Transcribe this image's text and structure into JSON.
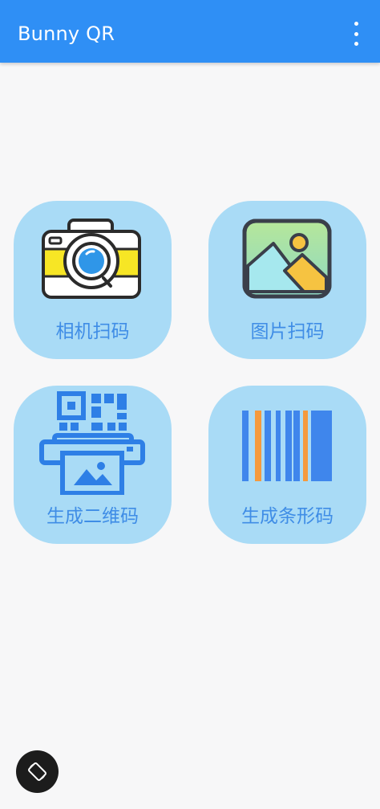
{
  "appbar": {
    "title": "Bunny QR",
    "overflow_icon": "more-vert-icon",
    "color": "#2f8ff5"
  },
  "tiles": [
    {
      "label": "相机扫码",
      "icon": "camera-icon"
    },
    {
      "label": "图片扫码",
      "icon": "image-icon"
    },
    {
      "label": "生成二维码",
      "icon": "qr-generate-icon"
    },
    {
      "label": "生成条形码",
      "icon": "barcode-icon"
    }
  ],
  "fab": {
    "icon": "rotate-screen-icon"
  },
  "colors": {
    "tile_bg": "#a9dbf6",
    "tile_label": "#3f8de6",
    "background": "#f7f7f8"
  }
}
